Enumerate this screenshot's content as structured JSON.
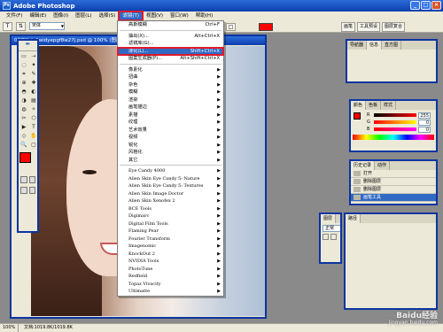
{
  "window": {
    "title": "Adobe Photoshop",
    "controls": [
      "_",
      "□",
      "×"
    ]
  },
  "menubar": {
    "items": [
      "文件(F)",
      "编辑(E)",
      "图像(I)",
      "图层(L)",
      "选择(S)",
      "滤镜(T)",
      "视图(V)",
      "窗口(W)",
      "帮助(H)"
    ]
  },
  "optionsbar": {
    "font": "宋体",
    "font_arrow": "▼",
    "tool_icon": "T",
    "color_button": "□",
    "palette_tabs": [
      "画笔",
      "工具预设",
      "图层复合"
    ]
  },
  "toolbox": {
    "logo_icon": "feather-icon",
    "tools": [
      "▭",
      "⇢",
      "◌",
      "✦",
      "⌗",
      "✎",
      "⊕",
      "✚",
      "◓",
      "◐",
      "◑",
      "▤",
      "◍",
      "✧",
      "✂",
      "⬡",
      "▶",
      "T",
      "◇",
      "✋",
      "🔍",
      "▢"
    ]
  },
  "document": {
    "title": "02fEXchdiwidyepgf8w27j.psd @ 100% (图层 1, RGB/8)"
  },
  "filter_menu": {
    "items": [
      {
        "label": "高斯模糊",
        "shortcut": "Ctrl+F"
      },
      {
        "sep": true
      },
      {
        "label": "抽出(X)...",
        "shortcut": "Alt+Ctrl+X"
      },
      {
        "label": "滤镜库(G)..."
      },
      {
        "label": "液化(L)...",
        "shortcut": "Shift+Ctrl+X",
        "highlight": true
      },
      {
        "label": "图案生成器(P)...",
        "shortcut": "Alt+Shift+Ctrl+X"
      },
      {
        "sep": true
      },
      {
        "label": "像素化",
        "arrow": true
      },
      {
        "label": "扭曲",
        "arrow": true
      },
      {
        "label": "杂色",
        "arrow": true
      },
      {
        "label": "模糊",
        "arrow": true
      },
      {
        "label": "渲染",
        "arrow": true
      },
      {
        "label": "画笔描边",
        "arrow": true
      },
      {
        "label": "素描",
        "arrow": true
      },
      {
        "label": "纹理",
        "arrow": true
      },
      {
        "label": "艺术效果",
        "arrow": true
      },
      {
        "label": "视频",
        "arrow": true
      },
      {
        "label": "锐化",
        "arrow": true
      },
      {
        "label": "风格化",
        "arrow": true
      },
      {
        "label": "其它",
        "arrow": true
      },
      {
        "sep": true
      },
      {
        "label": "Eye Candy 4000",
        "arrow": true,
        "plugin": true
      },
      {
        "label": "Alien Skin Eye Candy 5: Nature",
        "arrow": true,
        "plugin": true
      },
      {
        "label": "Alien Skin Eye Candy 5: Textures",
        "arrow": true,
        "plugin": true
      },
      {
        "label": "Alien Skin Image Doctor",
        "arrow": true,
        "plugin": true
      },
      {
        "label": "Alien Skin Xenofex 2",
        "arrow": true,
        "plugin": true
      },
      {
        "label": "BCE Tools",
        "arrow": true,
        "plugin": true
      },
      {
        "label": "Digimarc",
        "arrow": true,
        "plugin": true
      },
      {
        "label": "Digital Film Tools",
        "arrow": true,
        "plugin": true
      },
      {
        "label": "Flaming Pear",
        "arrow": true,
        "plugin": true
      },
      {
        "label": "Fourier Transform",
        "arrow": true,
        "plugin": true
      },
      {
        "label": "Imagenomic",
        "arrow": true,
        "plugin": true
      },
      {
        "label": "KnockOut 2",
        "arrow": true,
        "plugin": true
      },
      {
        "label": "NVIDIA Tools",
        "arrow": true,
        "plugin": true
      },
      {
        "label": "PhotoTune",
        "arrow": true,
        "plugin": true
      },
      {
        "label": "Redfield",
        "arrow": true,
        "plugin": true
      },
      {
        "label": "Topaz Vivacity",
        "arrow": true,
        "plugin": true
      },
      {
        "label": "Ultimatte",
        "arrow": true,
        "plugin": true
      }
    ]
  },
  "panels": {
    "navigator": {
      "tabs": [
        "导航器",
        "信息",
        "直方图"
      ]
    },
    "color": {
      "tabs": [
        "颜色",
        "色板",
        "样式"
      ],
      "sliders": [
        {
          "label": "R",
          "value": "255",
          "color": "#ff0000"
        },
        {
          "label": "G",
          "value": "0",
          "color": "#00aa00"
        },
        {
          "label": "B",
          "value": "0",
          "color": "#0000ff"
        }
      ]
    },
    "history": {
      "tabs": [
        "历史记录",
        "动作"
      ],
      "rows": [
        "打开",
        "删除图层",
        "删除图层",
        "画笔工具"
      ]
    },
    "layers": {
      "tabs": [
        "图层",
        "路径"
      ],
      "mode": "正常",
      "lock_label": "锁"
    }
  },
  "statusbar": {
    "zoom": "100%",
    "doc": "文档:1019.8K/1019.8K"
  },
  "watermark": {
    "brand": "Baidu经验",
    "url": "jingyan.baidu.com"
  },
  "colors": {
    "accent": "#316ac5",
    "window_border": "#0b35a0",
    "foreground": "#ff0000"
  }
}
